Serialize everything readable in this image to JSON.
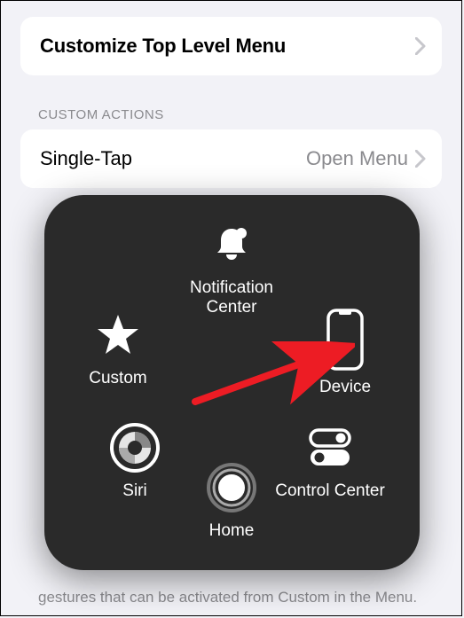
{
  "rows": {
    "customize": {
      "label": "Customize Top Level Menu"
    },
    "single_tap": {
      "label": "Single-Tap",
      "value": "Open Menu"
    }
  },
  "section_header": "CUSTOM ACTIONS",
  "footer_text": "gestures that can be activated from Custom in the Menu.",
  "popup": {
    "notification_center": "Notification Center",
    "custom": "Custom",
    "device": "Device",
    "siri": "Siri",
    "control_center": "Control Center",
    "home": "Home"
  }
}
